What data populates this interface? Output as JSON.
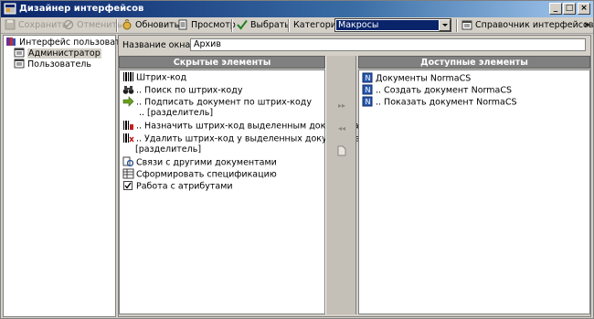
{
  "window": {
    "title": "Дизайнер интерфейсов"
  },
  "toolbar": {
    "save_label": "Сохранить",
    "cancel_label": "Отменить",
    "refresh_label": "Обновить",
    "preview_label": "Просмотр",
    "select_label": "Выбрать",
    "category_label": "Категория",
    "category_value": "Макросы",
    "directory_label": "Справочник интерфейсов"
  },
  "tree": {
    "root": "Интерфейс пользователя",
    "children": [
      "Администратор",
      "Пользователь"
    ]
  },
  "form": {
    "window_name_label": "Название окна:",
    "window_name_value": "Архив"
  },
  "hidden_panel": {
    "title": "Скрытые элементы",
    "items": [
      "Штрих-код",
      ".. Поиск по штрих-коду",
      ".. Подписать документ по штрих-коду",
      ".. [разделитель]",
      ".. Назначить штрих-код выделенным документам",
      ".. Удалить штрих-код у выделенных документов",
      "[разделитель]",
      "Связи с другими документами",
      "Сформировать спецификацию",
      "Работа с атрибутами"
    ]
  },
  "available_panel": {
    "title": "Доступные элементы",
    "items": [
      "Документы NormaCS",
      ".. Создать документ NormaCS",
      ".. Показать документ NormaCS"
    ]
  },
  "colors": {
    "titlebar": "#0a246a",
    "selection": "#0a246a",
    "panel_header": "#808080"
  }
}
